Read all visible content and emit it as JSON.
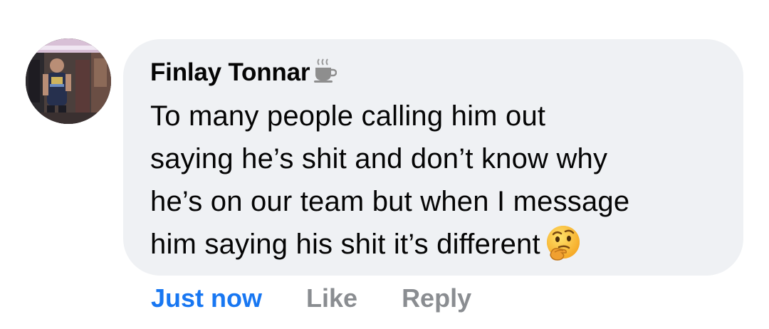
{
  "comment": {
    "author": "Finlay Tonnar",
    "badge_icon": "coffee-cup-icon",
    "text_lines": [
      "To many people calling him out",
      "saying he’s shit and don’t know why",
      "he’s on our team but when I message",
      "him saying his shit it’s different"
    ],
    "emoji_icon": "thinking-face-icon",
    "timestamp": "Just now",
    "like_label": "Like",
    "reply_label": "Reply"
  },
  "colors": {
    "bubble_bg": "#eff1f4",
    "timestamp": "#1877f2",
    "action_gray": "#8a8d91",
    "text": "#050505"
  }
}
